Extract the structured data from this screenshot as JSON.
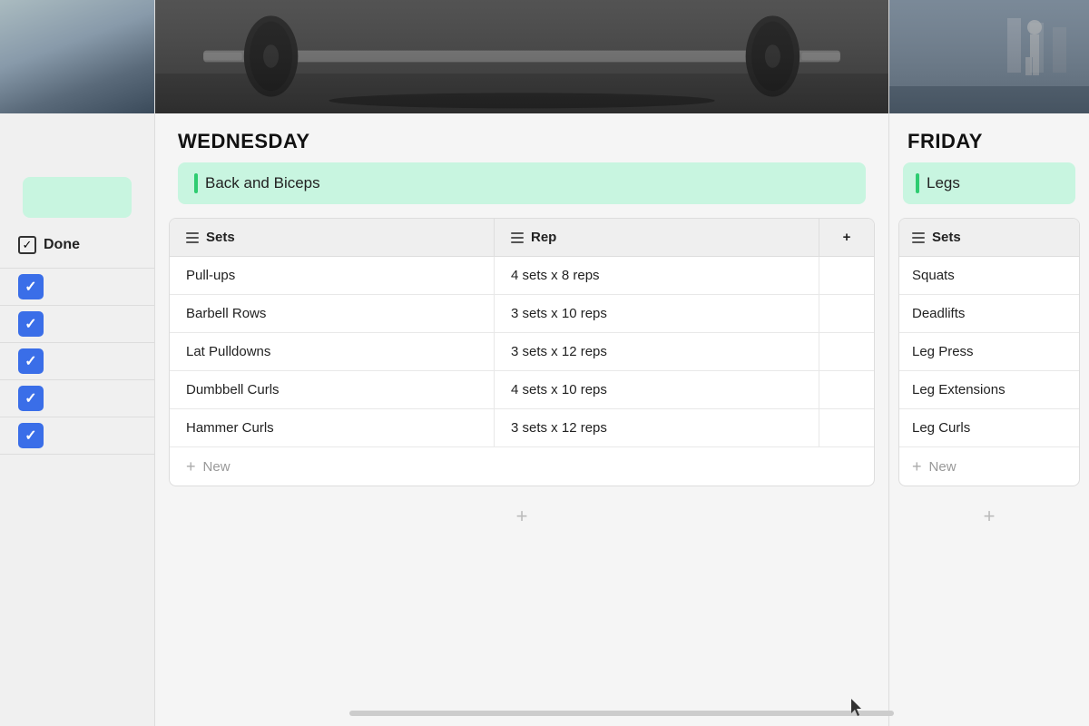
{
  "left": {
    "day_badge": "",
    "done_label": "Done",
    "checkboxes": [
      {
        "checked": true
      },
      {
        "checked": true
      },
      {
        "checked": true
      },
      {
        "checked": true
      },
      {
        "checked": true
      }
    ]
  },
  "wednesday": {
    "day": "WEDNESDAY",
    "workout_name": "Back and Biceps",
    "table": {
      "col1_header": "Sets",
      "col2_header": "Rep",
      "col3_header": "+",
      "rows": [
        {
          "exercise": "Pull-ups",
          "reps": "4 sets x 8 reps"
        },
        {
          "exercise": "Barbell Rows",
          "reps": "3 sets x 10 reps"
        },
        {
          "exercise": "Lat Pulldowns",
          "reps": "3 sets x 12 reps"
        },
        {
          "exercise": "Dumbbell Curls",
          "reps": "4 sets x 10 reps"
        },
        {
          "exercise": "Hammer Curls",
          "reps": "3 sets x 12 reps"
        }
      ],
      "new_label": "New"
    }
  },
  "friday": {
    "day": "FRIDAY",
    "workout_name": "Legs",
    "table": {
      "col1_header": "Sets",
      "rows": [
        {
          "exercise": "Squats"
        },
        {
          "exercise": "Deadlifts"
        },
        {
          "exercise": "Leg Press"
        },
        {
          "exercise": "Leg Extensions"
        },
        {
          "exercise": "Leg Curls"
        }
      ],
      "new_label": "New"
    }
  },
  "icons": {
    "checkmark": "✓",
    "plus": "+",
    "lines": "≡"
  },
  "colors": {
    "blue_checkbox": "#3a6ee8",
    "green_badge": "#c8f5e0",
    "green_bar": "#2ecc71"
  }
}
